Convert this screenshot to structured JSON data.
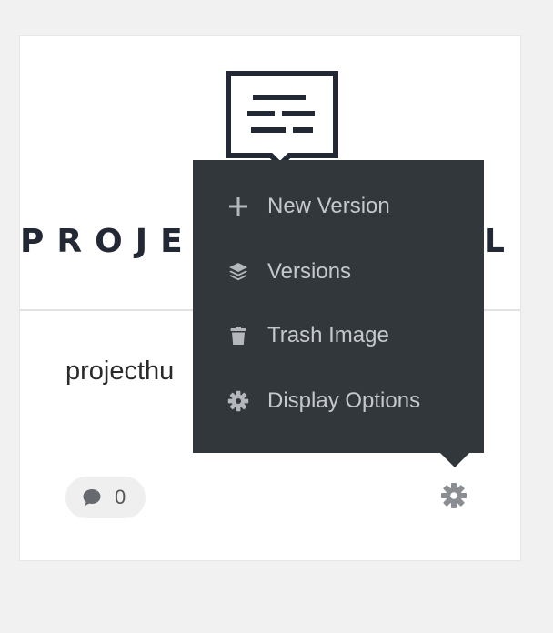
{
  "card": {
    "logo_text_left": "PROJE",
    "logo_text_right": "L",
    "title": "projecthu"
  },
  "footer": {
    "comment_count": "0",
    "comment_icon": "comment-icon",
    "settings_icon": "gear-icon"
  },
  "menu": {
    "items": [
      {
        "label": "New Version",
        "icon": "plus-icon"
      },
      {
        "label": "Versions",
        "icon": "layers-icon"
      },
      {
        "label": "Trash Image",
        "icon": "trash-icon"
      },
      {
        "label": "Display Options",
        "icon": "gear-icon"
      }
    ]
  },
  "colors": {
    "menu_bg": "#32373c",
    "menu_text": "#c5c8cc",
    "logo": "#222834",
    "page_bg": "#f1f1f1"
  }
}
